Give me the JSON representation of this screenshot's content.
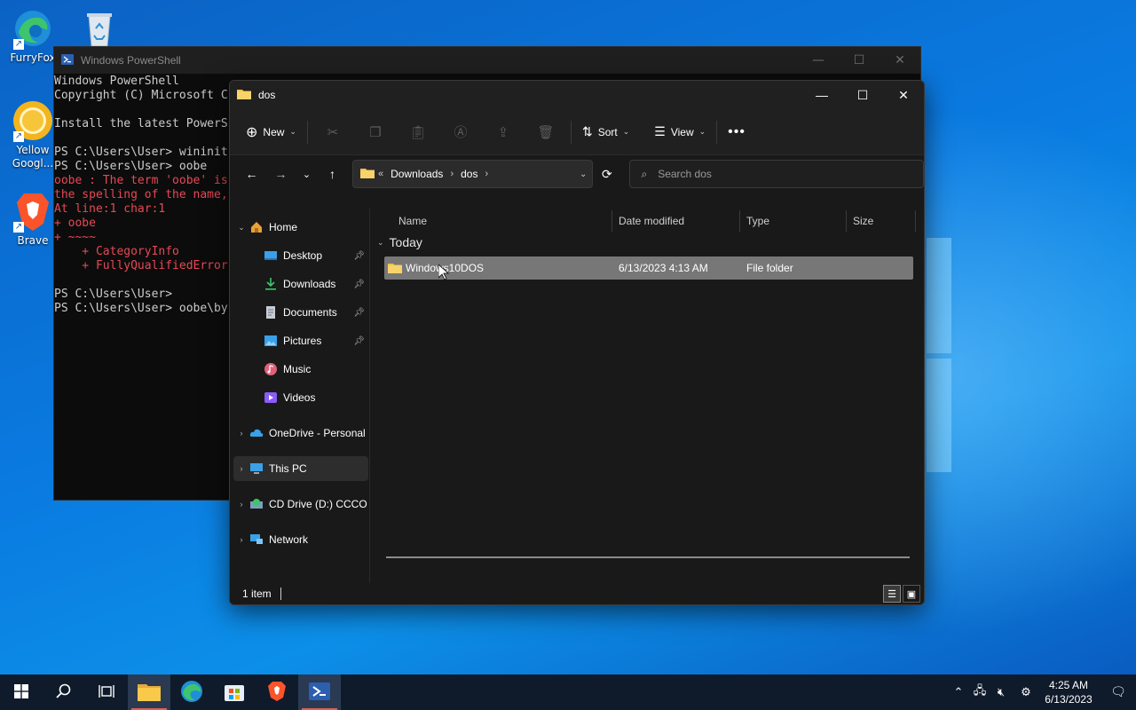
{
  "desktop": {
    "icons": [
      {
        "label": "FurryFox",
        "icon": "edge-browser-icon"
      },
      {
        "label": "",
        "icon": "recycle-bin-icon"
      },
      {
        "label": "Yellow Googl...",
        "icon": "chrome-browser-icon"
      },
      {
        "label": "Brave",
        "icon": "brave-browser-icon"
      }
    ]
  },
  "powershell": {
    "title": "Windows PowerShell",
    "lines": [
      {
        "text": "Windows PowerShell",
        "color": "normal"
      },
      {
        "text": "Copyright (C) Microsoft C",
        "color": "normal"
      },
      {
        "text": "",
        "color": "normal"
      },
      {
        "text": "Install the latest PowerS",
        "color": "normal"
      },
      {
        "text": "",
        "color": "normal"
      },
      {
        "text": "PS C:\\Users\\User> wininit",
        "color": "normal"
      },
      {
        "text": "PS C:\\Users\\User> oobe",
        "color": "normal"
      },
      {
        "text": "oobe : The term 'oobe' is",
        "color": "red"
      },
      {
        "text": "the spelling of the name,",
        "color": "red"
      },
      {
        "text": "At line:1 char:1",
        "color": "red"
      },
      {
        "text": "+ oobe",
        "color": "red"
      },
      {
        "text": "+ ~~~~",
        "color": "red"
      },
      {
        "text": "    + CategoryInfo",
        "color": "red"
      },
      {
        "text": "    + FullyQualifiedError",
        "color": "red"
      },
      {
        "text": "",
        "color": "normal"
      },
      {
        "text": "PS C:\\Users\\User>",
        "color": "normal"
      },
      {
        "text": "PS C:\\Users\\User> oobe\\by",
        "color": "normal"
      }
    ]
  },
  "explorer": {
    "title": "dos",
    "toolbar": {
      "new_label": "New",
      "sort_label": "Sort",
      "view_label": "View"
    },
    "address": {
      "overflow": "«",
      "crumbs": [
        "Downloads",
        "dos"
      ]
    },
    "search": {
      "placeholder": "Search dos"
    },
    "nav": [
      {
        "label": "Home",
        "icon": "home-icon",
        "pinned": false,
        "expanded": true
      },
      {
        "label": "Desktop",
        "icon": "desktop-icon",
        "pinned": true
      },
      {
        "label": "Downloads",
        "icon": "downloads-icon",
        "pinned": true
      },
      {
        "label": "Documents",
        "icon": "documents-icon",
        "pinned": true
      },
      {
        "label": "Pictures",
        "icon": "pictures-icon",
        "pinned": true
      },
      {
        "label": "Music",
        "icon": "music-icon",
        "pinned": false
      },
      {
        "label": "Videos",
        "icon": "videos-icon",
        "pinned": false
      },
      {
        "label": "OneDrive - Personal",
        "icon": "onedrive-icon",
        "pinned": false
      },
      {
        "label": "This PC",
        "icon": "this-pc-icon",
        "pinned": false
      },
      {
        "label": "CD Drive (D:) CCCO",
        "icon": "cd-drive-icon",
        "pinned": false
      },
      {
        "label": "Network",
        "icon": "network-icon",
        "pinned": false
      }
    ],
    "columns": {
      "name": "Name",
      "date": "Date modified",
      "type": "Type",
      "size": "Size"
    },
    "group_label": "Today",
    "rows": [
      {
        "name": "Windows10DOS",
        "date": "6/13/2023 4:13 AM",
        "type": "File folder",
        "size": ""
      }
    ],
    "status": {
      "count": "1 item"
    }
  },
  "taskbar": {
    "clock_time": "4:25 AM",
    "clock_date": "6/13/2023"
  }
}
